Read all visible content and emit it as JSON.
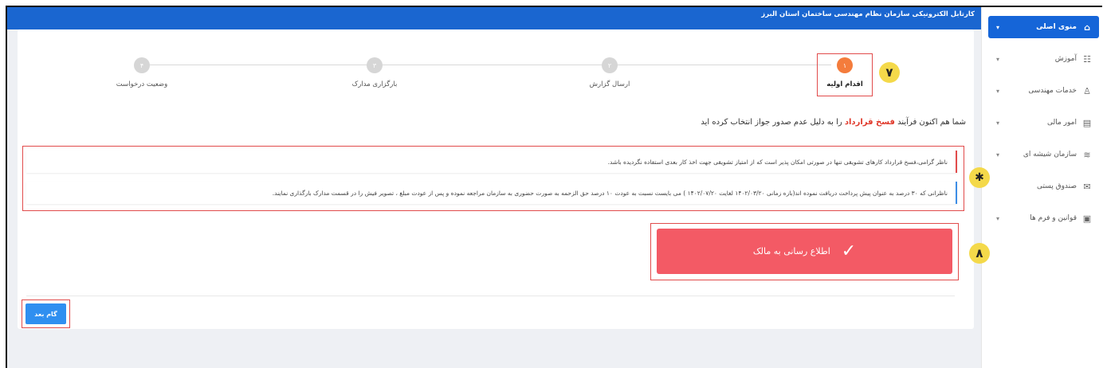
{
  "app": {
    "title": "کارتابل الکترونیکی سازمان نظام مهندسی ساختمان استان البرز"
  },
  "sidebar": {
    "items": [
      {
        "label": "منوی اصلی",
        "icon": "home-icon",
        "glyph": "⌂",
        "caret": "▾"
      },
      {
        "label": "آموزش",
        "icon": "education-icon",
        "glyph": "☷",
        "caret": "▾"
      },
      {
        "label": "خدمات مهندسی",
        "icon": "engineer-icon",
        "glyph": "♙",
        "caret": "▾"
      },
      {
        "label": "امور مالی",
        "icon": "finance-icon",
        "glyph": "▤",
        "caret": "▾"
      },
      {
        "label": "سازمان شیشه ای",
        "icon": "chart-icon",
        "glyph": "≋",
        "caret": "▾"
      },
      {
        "label": "صندوق پستی",
        "icon": "mailbox-icon",
        "glyph": "✉"
      },
      {
        "label": "قوانین و فرم ها",
        "icon": "folder-icon",
        "glyph": "▣",
        "caret": "▾"
      }
    ]
  },
  "stepper": {
    "steps": [
      {
        "number": "۱",
        "label": "اقدام اولیه",
        "active": true
      },
      {
        "number": "۲",
        "label": "ارسال گزارش",
        "active": false
      },
      {
        "number": "۳",
        "label": "بارگزاری مدارک",
        "active": false
      },
      {
        "number": "۴",
        "label": "وضعیت درخواست",
        "active": false
      }
    ]
  },
  "headline": {
    "prefix": "شما هم اکنون فرآیند",
    "highlight": "فسخ قرارداد",
    "suffix": "را به دلیل عدم صدور جواز انتخاب کرده اید"
  },
  "notices": [
    "ناظر گرامی،فسخ قرارداد کارهای تشویقی تنها در صورتی امکان پذیر است که از امتیاز تشویقی جهت اخذ کار بعدی استفاده نگردیده باشد.",
    "ناظرانی که ۳۰ درصد به عنوان پیش پرداخت دریافت نموده اند(بازه زمانی ۱۴۰۲/۰۳/۲۰ لغایت ۱۴۰۲/۰۷/۲۰ ) می بایست نسبت به عودت ۱۰ درصد حق الزحمه به صورت حضوری به سازمان مراجعه نموده و پس از عودت مبلغ ، تصویر فیش را در قسمت مدارک بارگذاری نمایند."
  ],
  "actions": {
    "notify_label": "اطلاع رسانی به مالک",
    "next_label": "گام بعد"
  },
  "markers": {
    "step": "۷",
    "notices": "✱",
    "notify": "۸"
  },
  "colors": {
    "header": "#1a66d0",
    "active_menu": "#1565d8",
    "active_step": "#f47c3c",
    "notify_button": "#f35a65",
    "next_button": "#2f8ff0",
    "highlight_text": "#e0392b",
    "annotation_box": "#e14b4b",
    "marker": "#f4d94a"
  }
}
